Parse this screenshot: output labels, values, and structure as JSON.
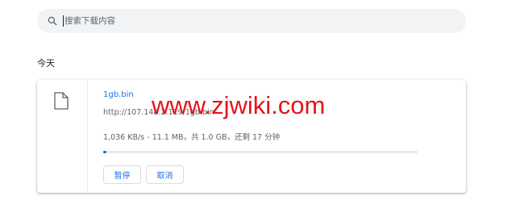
{
  "search": {
    "placeholder": "搜索下载内容",
    "value": ""
  },
  "date_header": "今天",
  "download": {
    "file_name": "1gb.bin",
    "url": "http://107.148.2.119/1gb.bin",
    "status": "1,036 KB/s - 11.1 MB，共 1.0 GB，还剩 17 分钟",
    "progress_fraction": 0.011,
    "pause_label": "暂停",
    "cancel_label": "取消"
  },
  "watermark": "www.zjwiki.com",
  "colors": {
    "accent": "#1a73e8",
    "watermark": "#e6141a",
    "search_bg": "#f1f3f4"
  },
  "icons": {
    "search": "search-icon",
    "file": "file-icon"
  }
}
